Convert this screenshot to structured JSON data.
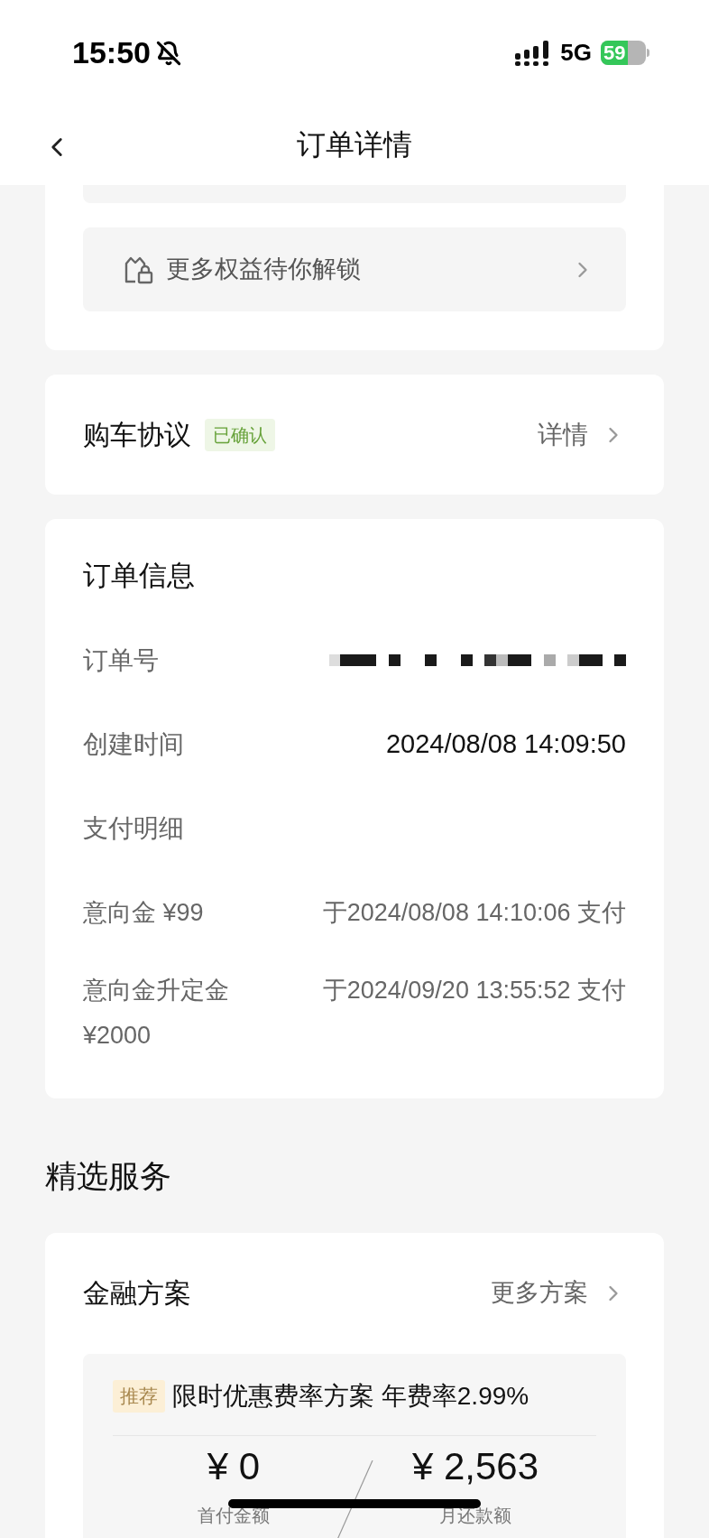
{
  "status_bar": {
    "time": "15:50",
    "network": "5G",
    "battery": "59"
  },
  "nav": {
    "title": "订单详情"
  },
  "benefits": {
    "label": "更多权益待你解锁"
  },
  "agreement": {
    "title": "购车协议",
    "status": "已确认",
    "link": "详情"
  },
  "order_info": {
    "title": "订单信息",
    "rows": [
      {
        "label": "订单号",
        "kind": "redacted"
      },
      {
        "label": "创建时间",
        "kind": "text",
        "value": "2024/08/08 14:09:50"
      }
    ],
    "payment": {
      "title": "支付明细",
      "items": [
        {
          "label": "意向金 ¥99",
          "value": "于2024/08/08 14:10:06 支付"
        },
        {
          "label": "意向金升定金 ¥2000",
          "value": "于2024/09/20 13:55:52 支付"
        }
      ]
    }
  },
  "services": {
    "title": "精选服务",
    "finance": {
      "title": "金融方案",
      "more": "更多方案",
      "plan": {
        "tag": "推荐",
        "name": "限时优惠费率方案 年费率2.99%",
        "amounts": [
          {
            "value": "¥ 0",
            "label": "首付金额"
          },
          {
            "value": "¥ 2,563",
            "label": "月还款额"
          }
        ]
      }
    }
  }
}
